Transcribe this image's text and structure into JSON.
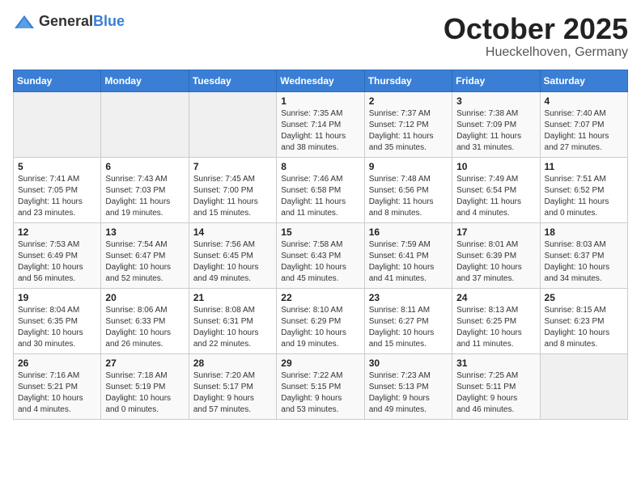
{
  "header": {
    "logo_general": "General",
    "logo_blue": "Blue",
    "month": "October 2025",
    "location": "Hueckelhoven, Germany"
  },
  "weekdays": [
    "Sunday",
    "Monday",
    "Tuesday",
    "Wednesday",
    "Thursday",
    "Friday",
    "Saturday"
  ],
  "weeks": [
    [
      {
        "day": "",
        "content": ""
      },
      {
        "day": "",
        "content": ""
      },
      {
        "day": "",
        "content": ""
      },
      {
        "day": "1",
        "content": "Sunrise: 7:35 AM\nSunset: 7:14 PM\nDaylight: 11 hours\nand 38 minutes."
      },
      {
        "day": "2",
        "content": "Sunrise: 7:37 AM\nSunset: 7:12 PM\nDaylight: 11 hours\nand 35 minutes."
      },
      {
        "day": "3",
        "content": "Sunrise: 7:38 AM\nSunset: 7:09 PM\nDaylight: 11 hours\nand 31 minutes."
      },
      {
        "day": "4",
        "content": "Sunrise: 7:40 AM\nSunset: 7:07 PM\nDaylight: 11 hours\nand 27 minutes."
      }
    ],
    [
      {
        "day": "5",
        "content": "Sunrise: 7:41 AM\nSunset: 7:05 PM\nDaylight: 11 hours\nand 23 minutes."
      },
      {
        "day": "6",
        "content": "Sunrise: 7:43 AM\nSunset: 7:03 PM\nDaylight: 11 hours\nand 19 minutes."
      },
      {
        "day": "7",
        "content": "Sunrise: 7:45 AM\nSunset: 7:00 PM\nDaylight: 11 hours\nand 15 minutes."
      },
      {
        "day": "8",
        "content": "Sunrise: 7:46 AM\nSunset: 6:58 PM\nDaylight: 11 hours\nand 11 minutes."
      },
      {
        "day": "9",
        "content": "Sunrise: 7:48 AM\nSunset: 6:56 PM\nDaylight: 11 hours\nand 8 minutes."
      },
      {
        "day": "10",
        "content": "Sunrise: 7:49 AM\nSunset: 6:54 PM\nDaylight: 11 hours\nand 4 minutes."
      },
      {
        "day": "11",
        "content": "Sunrise: 7:51 AM\nSunset: 6:52 PM\nDaylight: 11 hours\nand 0 minutes."
      }
    ],
    [
      {
        "day": "12",
        "content": "Sunrise: 7:53 AM\nSunset: 6:49 PM\nDaylight: 10 hours\nand 56 minutes."
      },
      {
        "day": "13",
        "content": "Sunrise: 7:54 AM\nSunset: 6:47 PM\nDaylight: 10 hours\nand 52 minutes."
      },
      {
        "day": "14",
        "content": "Sunrise: 7:56 AM\nSunset: 6:45 PM\nDaylight: 10 hours\nand 49 minutes."
      },
      {
        "day": "15",
        "content": "Sunrise: 7:58 AM\nSunset: 6:43 PM\nDaylight: 10 hours\nand 45 minutes."
      },
      {
        "day": "16",
        "content": "Sunrise: 7:59 AM\nSunset: 6:41 PM\nDaylight: 10 hours\nand 41 minutes."
      },
      {
        "day": "17",
        "content": "Sunrise: 8:01 AM\nSunset: 6:39 PM\nDaylight: 10 hours\nand 37 minutes."
      },
      {
        "day": "18",
        "content": "Sunrise: 8:03 AM\nSunset: 6:37 PM\nDaylight: 10 hours\nand 34 minutes."
      }
    ],
    [
      {
        "day": "19",
        "content": "Sunrise: 8:04 AM\nSunset: 6:35 PM\nDaylight: 10 hours\nand 30 minutes."
      },
      {
        "day": "20",
        "content": "Sunrise: 8:06 AM\nSunset: 6:33 PM\nDaylight: 10 hours\nand 26 minutes."
      },
      {
        "day": "21",
        "content": "Sunrise: 8:08 AM\nSunset: 6:31 PM\nDaylight: 10 hours\nand 22 minutes."
      },
      {
        "day": "22",
        "content": "Sunrise: 8:10 AM\nSunset: 6:29 PM\nDaylight: 10 hours\nand 19 minutes."
      },
      {
        "day": "23",
        "content": "Sunrise: 8:11 AM\nSunset: 6:27 PM\nDaylight: 10 hours\nand 15 minutes."
      },
      {
        "day": "24",
        "content": "Sunrise: 8:13 AM\nSunset: 6:25 PM\nDaylight: 10 hours\nand 11 minutes."
      },
      {
        "day": "25",
        "content": "Sunrise: 8:15 AM\nSunset: 6:23 PM\nDaylight: 10 hours\nand 8 minutes."
      }
    ],
    [
      {
        "day": "26",
        "content": "Sunrise: 7:16 AM\nSunset: 5:21 PM\nDaylight: 10 hours\nand 4 minutes."
      },
      {
        "day": "27",
        "content": "Sunrise: 7:18 AM\nSunset: 5:19 PM\nDaylight: 10 hours\nand 0 minutes."
      },
      {
        "day": "28",
        "content": "Sunrise: 7:20 AM\nSunset: 5:17 PM\nDaylight: 9 hours\nand 57 minutes."
      },
      {
        "day": "29",
        "content": "Sunrise: 7:22 AM\nSunset: 5:15 PM\nDaylight: 9 hours\nand 53 minutes."
      },
      {
        "day": "30",
        "content": "Sunrise: 7:23 AM\nSunset: 5:13 PM\nDaylight: 9 hours\nand 49 minutes."
      },
      {
        "day": "31",
        "content": "Sunrise: 7:25 AM\nSunset: 5:11 PM\nDaylight: 9 hours\nand 46 minutes."
      },
      {
        "day": "",
        "content": ""
      }
    ]
  ]
}
